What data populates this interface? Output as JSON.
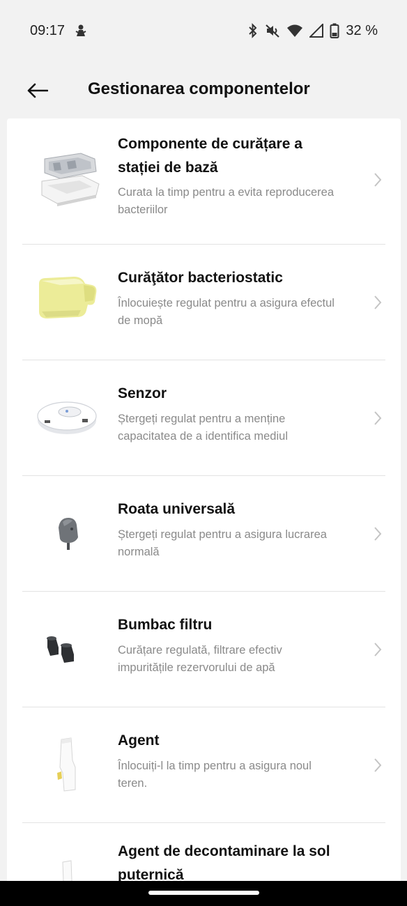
{
  "status": {
    "time": "09:17",
    "battery": "32 %"
  },
  "header": {
    "title": "Gestionarea componentelor"
  },
  "items": [
    {
      "title_line1": "Componente de curățare a",
      "title_line2": "stației de bază",
      "desc_line1": "Curata la timp pentru a evita reproducerea",
      "desc_line2": "bacteriilor"
    },
    {
      "title_line1": "Curăţător bacteriostatic",
      "desc_line1": "Înlocuiește regulat pentru a asigura efectul",
      "desc_line2": "de mopă"
    },
    {
      "title_line1": "Senzor",
      "desc_line1": "Ștergeți regulat pentru a menține",
      "desc_line2": "capacitatea de a identifica mediul"
    },
    {
      "title_line1": "Roata universală",
      "desc_line1": "Ștergeți regulat pentru a asigura lucrarea",
      "desc_line2": "normală"
    },
    {
      "title_line1": "Bumbac filtru",
      "desc_line1": "Curățare regulată, filtrare efectiv",
      "desc_line2": "impuritățile rezervorului de apă"
    },
    {
      "title_line1": "Agent",
      "desc_line1": "Înlocuiți-l la timp pentru a asigura noul",
      "desc_line2": "teren."
    },
    {
      "title_line1": "Agent de decontaminare la sol",
      "title_line2": "puternică"
    }
  ]
}
